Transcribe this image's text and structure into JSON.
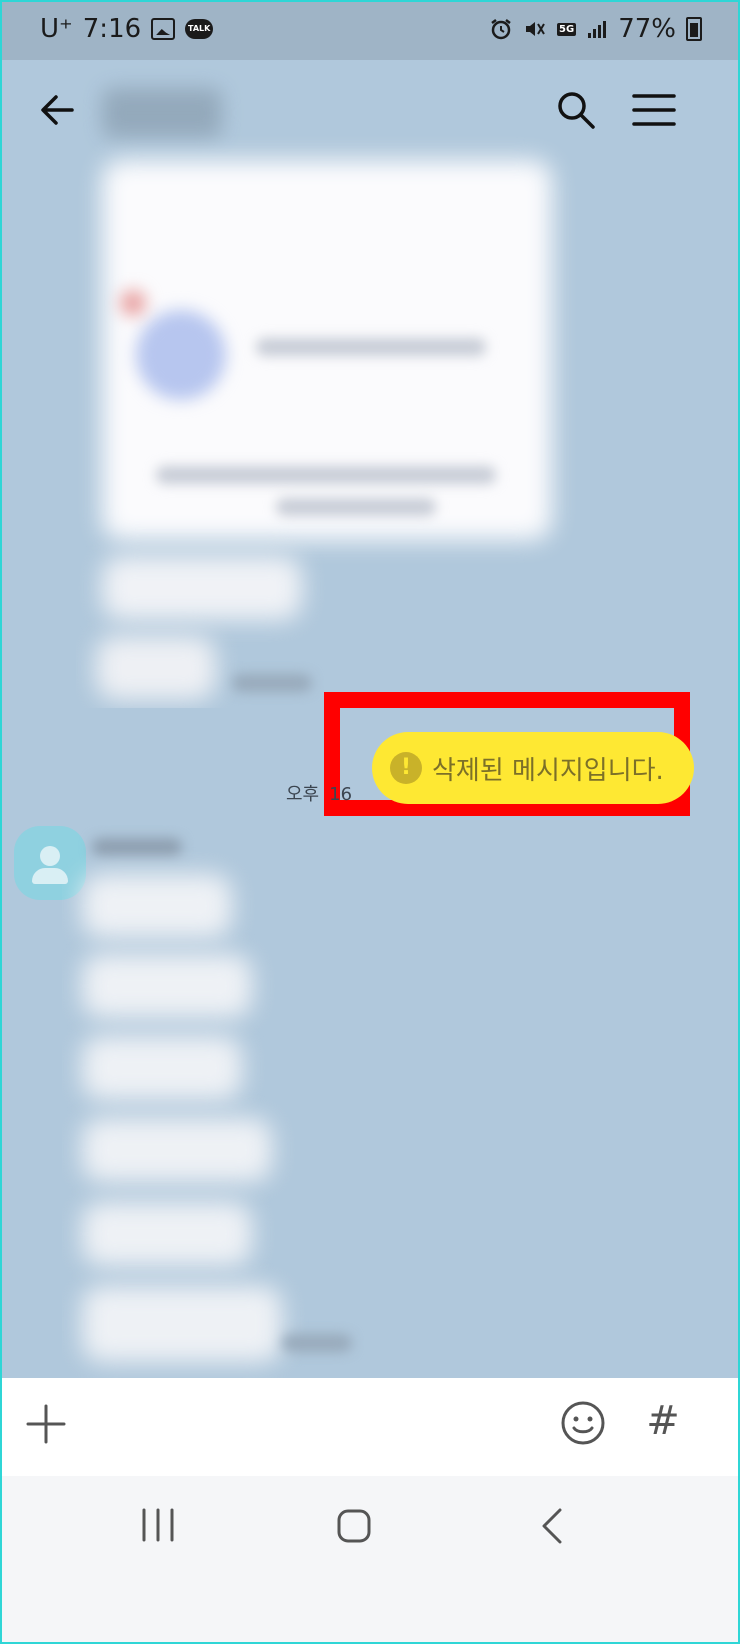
{
  "status_bar": {
    "carrier": "U⁺",
    "time": "7:16",
    "talk_badge": "TALK",
    "network_badge": "5G",
    "battery": "77%"
  },
  "header": {
    "back_icon": "arrow-left-icon",
    "search_icon": "search-icon",
    "menu_icon": "hamburger-menu-icon"
  },
  "message": {
    "deleted_text": "삭제된 메시지입니다.",
    "alert_glyph": "!",
    "time_prefix": "오후",
    "time_suffix": "16"
  },
  "input_bar": {
    "plus_icon": "plus-icon",
    "emoji_icon": "emoji-icon",
    "hashtag": "#"
  },
  "nav_bar": {
    "recent_icon": "recent-apps-icon",
    "home_icon": "home-icon",
    "back_icon": "back-chevron-icon"
  },
  "colors": {
    "chat_bg": "#b0c8dc",
    "bubble": "#fee833",
    "highlight": "#ff0000",
    "frame_border": "#2fd6d6"
  }
}
